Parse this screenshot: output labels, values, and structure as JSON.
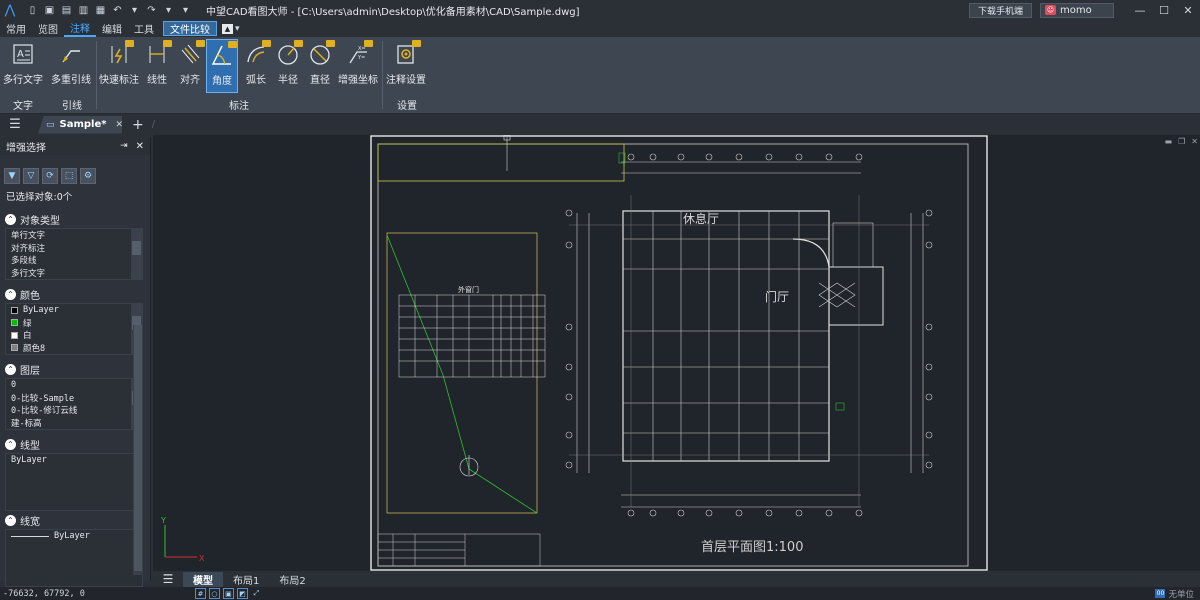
{
  "window": {
    "title": "中望CAD看图大师 - [C:\\Users\\admin\\Desktop\\优化备用素材\\CAD\\Sample.dwg]",
    "download_button": "下载手机端",
    "user_name": "momo"
  },
  "menu": {
    "items": [
      "常用",
      "览图",
      "注释",
      "编辑",
      "工具"
    ],
    "active_index": 2,
    "compare": "文件比较"
  },
  "ribbon": {
    "buttons": [
      {
        "label": "多行文字"
      },
      {
        "label": "多重引线"
      },
      {
        "label": "快速标注"
      },
      {
        "label": "线性"
      },
      {
        "label": "对齐"
      },
      {
        "label": "角度"
      },
      {
        "label": "弧长"
      },
      {
        "label": "半径"
      },
      {
        "label": "直径"
      },
      {
        "label": "增强坐标"
      },
      {
        "label": "注释设置"
      }
    ],
    "groups": [
      "文字",
      "引线",
      "标注",
      "设置"
    ]
  },
  "document_tab": {
    "name": "Sample*"
  },
  "panel": {
    "title": "增强选择",
    "selected_count": "已选择对象:0个",
    "sections": [
      {
        "title": "对象类型",
        "items": [
          "单行文字",
          "对齐标注",
          "多段线",
          "多行文字"
        ]
      },
      {
        "title": "颜色",
        "items": [
          "ByLayer",
          "绿",
          "白",
          "颜色8"
        ]
      },
      {
        "title": "图层",
        "items": [
          "0",
          "0-比较-Sample",
          "0-比较-修订云线",
          "建-标高"
        ]
      },
      {
        "title": "线型",
        "items": [
          "ByLayer"
        ]
      },
      {
        "title": "线宽",
        "items": [
          "ByLayer"
        ]
      }
    ],
    "color_swatches": [
      "#000000",
      "#00c000",
      "#ffffff",
      "#808080"
    ]
  },
  "drawing": {
    "table_title": "外窗门",
    "room_labels": [
      "休息厅",
      "门厅"
    ],
    "plan_title": "首层平面图1:100",
    "axis_x": "X",
    "axis_y": "Y"
  },
  "layout_tabs": [
    "模型",
    "布局1",
    "布局2"
  ],
  "status": {
    "coordinates": "-76632, 67792, 0",
    "units": "无单位"
  }
}
